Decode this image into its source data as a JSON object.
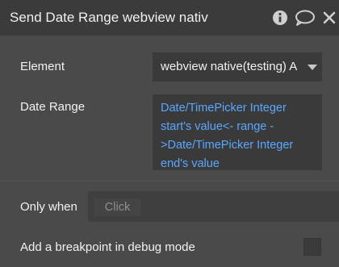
{
  "header": {
    "title": "Send Date Range webview nativ",
    "icons": [
      "info-icon",
      "comment-icon",
      "close-icon"
    ]
  },
  "fields": {
    "element": {
      "label": "Element",
      "value": "webview native(testing) A"
    },
    "date_range": {
      "label": "Date Range",
      "value": "Date/TimePicker Integer start's value<- range ->Date/TimePicker Integer end's value"
    },
    "only_when": {
      "label": "Only when",
      "placeholder": "Click"
    },
    "breakpoint": {
      "label": "Add a breakpoint in debug mode",
      "checked": false
    }
  },
  "colors": {
    "panel_bg": "#4a4a4a",
    "header_bg": "#3b3b3b",
    "input_bg": "#3a3a3a",
    "dynamic_text": "#5aa7ff",
    "label_text": "#f2f2f2"
  }
}
